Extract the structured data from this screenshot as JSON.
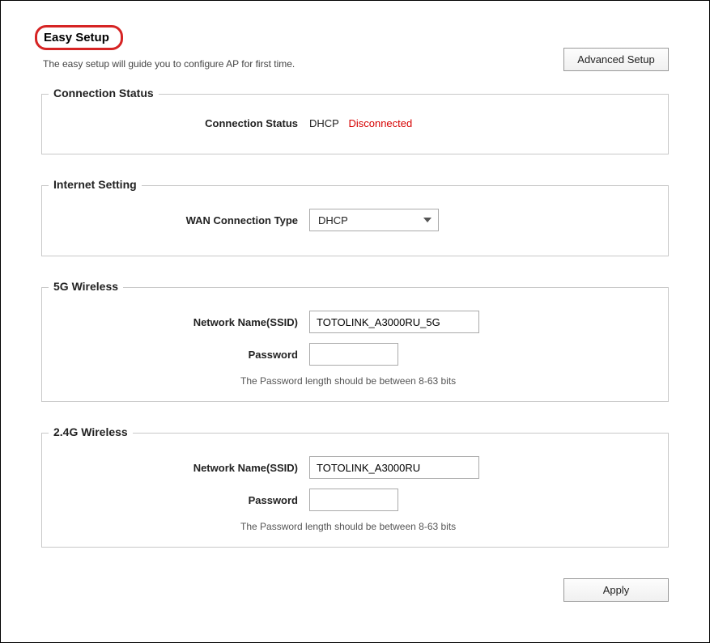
{
  "header": {
    "title": "Easy Setup",
    "subtitle": "The easy setup will guide you to configure AP for first time.",
    "advanced_button": "Advanced Setup"
  },
  "connection_status": {
    "legend": "Connection Status",
    "label": "Connection Status",
    "mode": "DHCP",
    "state": "Disconnected"
  },
  "internet_setting": {
    "legend": "Internet Setting",
    "wan_label": "WAN Connection Type",
    "wan_selected": "DHCP"
  },
  "wireless_5g": {
    "legend": "5G Wireless",
    "ssid_label": "Network Name(SSID)",
    "ssid_value": "TOTOLINK_A3000RU_5G",
    "password_label": "Password",
    "password_value": "",
    "hint": "The Password length should be between 8-63 bits"
  },
  "wireless_24g": {
    "legend": "2.4G Wireless",
    "ssid_label": "Network Name(SSID)",
    "ssid_value": "TOTOLINK_A3000RU",
    "password_label": "Password",
    "password_value": "",
    "hint": "The Password length should be between 8-63 bits"
  },
  "footer": {
    "apply_button": "Apply"
  }
}
